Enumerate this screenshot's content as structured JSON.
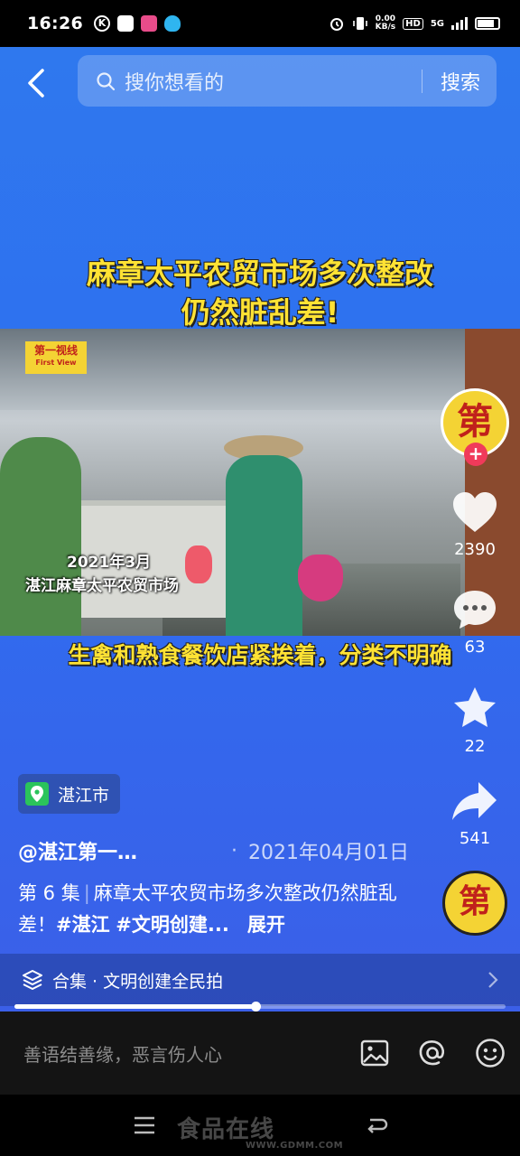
{
  "status_bar": {
    "time": "16:26",
    "network_speed": "0.00",
    "network_unit": "KB/s",
    "hd": "HD",
    "network": "5G"
  },
  "search": {
    "placeholder": "搜你想看的",
    "button": "搜索"
  },
  "video": {
    "headline_line1": "麻章太平农贸市场多次整改",
    "headline_line2": "仍然脏乱差!",
    "logo_line1": "第一视线",
    "logo_line2": "First View",
    "caption_line1": "2021年3月",
    "caption_line2": "湛江麻章太平农贸市场",
    "subtitle": "生禽和熟食餐饮店紧挨着，分类不明确"
  },
  "actions": {
    "like_count": "2390",
    "comment_count": "63",
    "favorite_count": "22",
    "share_count": "541"
  },
  "avatar_text": "第",
  "post": {
    "location": "湛江市",
    "author": "@湛江第一…",
    "separator": "·",
    "date": "2021年04月01日",
    "episode": "第 6 集",
    "episode_sep": "|",
    "title_part": "麻章太平农贸市场多次整改仍然脏乱差！",
    "tag1": "#湛江",
    "tag2": "#文明创建...",
    "expand": "展开"
  },
  "collection": {
    "label": "合集 · 文明创建全民拍"
  },
  "playback": {
    "progress": 0.49
  },
  "comment_bar": {
    "placeholder": "善语结善缘，恶言伤人心"
  },
  "watermark": {
    "text": "食品在线",
    "url": "WWW.GDMM.COM"
  },
  "colors": {
    "accent_yellow": "#ffe234",
    "follow_red": "#f03a5a",
    "location_green": "#2bc45b",
    "background_blue": "#2f78ee"
  }
}
